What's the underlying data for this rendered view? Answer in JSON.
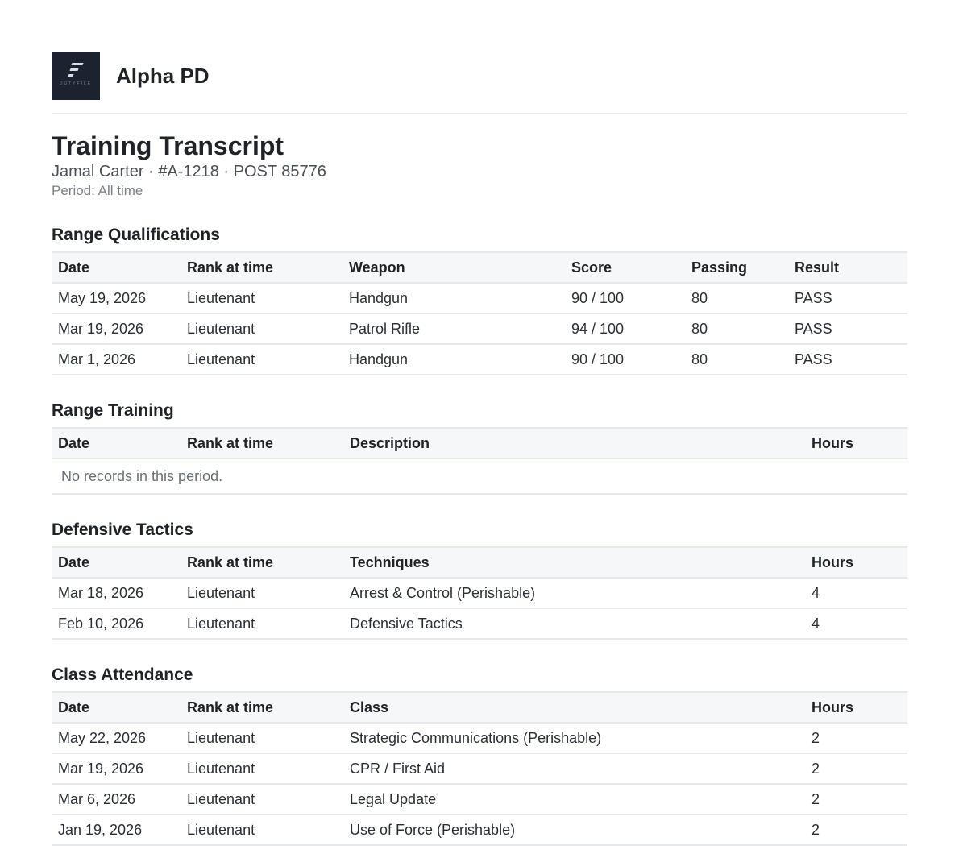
{
  "header": {
    "logo_text": "DUTYFILE",
    "org_name": "Alpha PD"
  },
  "title": "Training Transcript",
  "subtitle": "Jamal Carter · #A-1218 · POST 85776",
  "period": "Period: All time",
  "range_qualifications": {
    "title": "Range Qualifications",
    "columns": [
      "Date",
      "Rank at time",
      "Weapon",
      "Score",
      "Passing",
      "Result"
    ],
    "rows": [
      [
        "May 19, 2026",
        "Lieutenant",
        "Handgun",
        "90 / 100",
        "80",
        "PASS"
      ],
      [
        "Mar 19, 2026",
        "Lieutenant",
        "Patrol Rifle",
        "94 / 100",
        "80",
        "PASS"
      ],
      [
        "Mar 1, 2026",
        "Lieutenant",
        "Handgun",
        "90 / 100",
        "80",
        "PASS"
      ]
    ]
  },
  "range_training": {
    "title": "Range Training",
    "columns": [
      "Date",
      "Rank at time",
      "Description",
      "Hours"
    ],
    "empty_message": "No records in this period."
  },
  "defensive_tactics": {
    "title": "Defensive Tactics",
    "columns": [
      "Date",
      "Rank at time",
      "Techniques",
      "Hours"
    ],
    "rows": [
      [
        "Mar 18, 2026",
        "Lieutenant",
        "Arrest & Control (Perishable)",
        "4"
      ],
      [
        "Feb 10, 2026",
        "Lieutenant",
        "Defensive Tactics",
        "4"
      ]
    ]
  },
  "class_attendance": {
    "title": "Class Attendance",
    "columns": [
      "Date",
      "Rank at time",
      "Class",
      "Hours"
    ],
    "rows": [
      [
        "May 22, 2026",
        "Lieutenant",
        "Strategic Communications (Perishable)",
        "2"
      ],
      [
        "Mar 19, 2026",
        "Lieutenant",
        "CPR / First Aid",
        "2"
      ],
      [
        "Mar 6, 2026",
        "Lieutenant",
        "Legal Update",
        "2"
      ],
      [
        "Jan 19, 2026",
        "Lieutenant",
        "Use of Force (Perishable)",
        "2"
      ]
    ]
  }
}
